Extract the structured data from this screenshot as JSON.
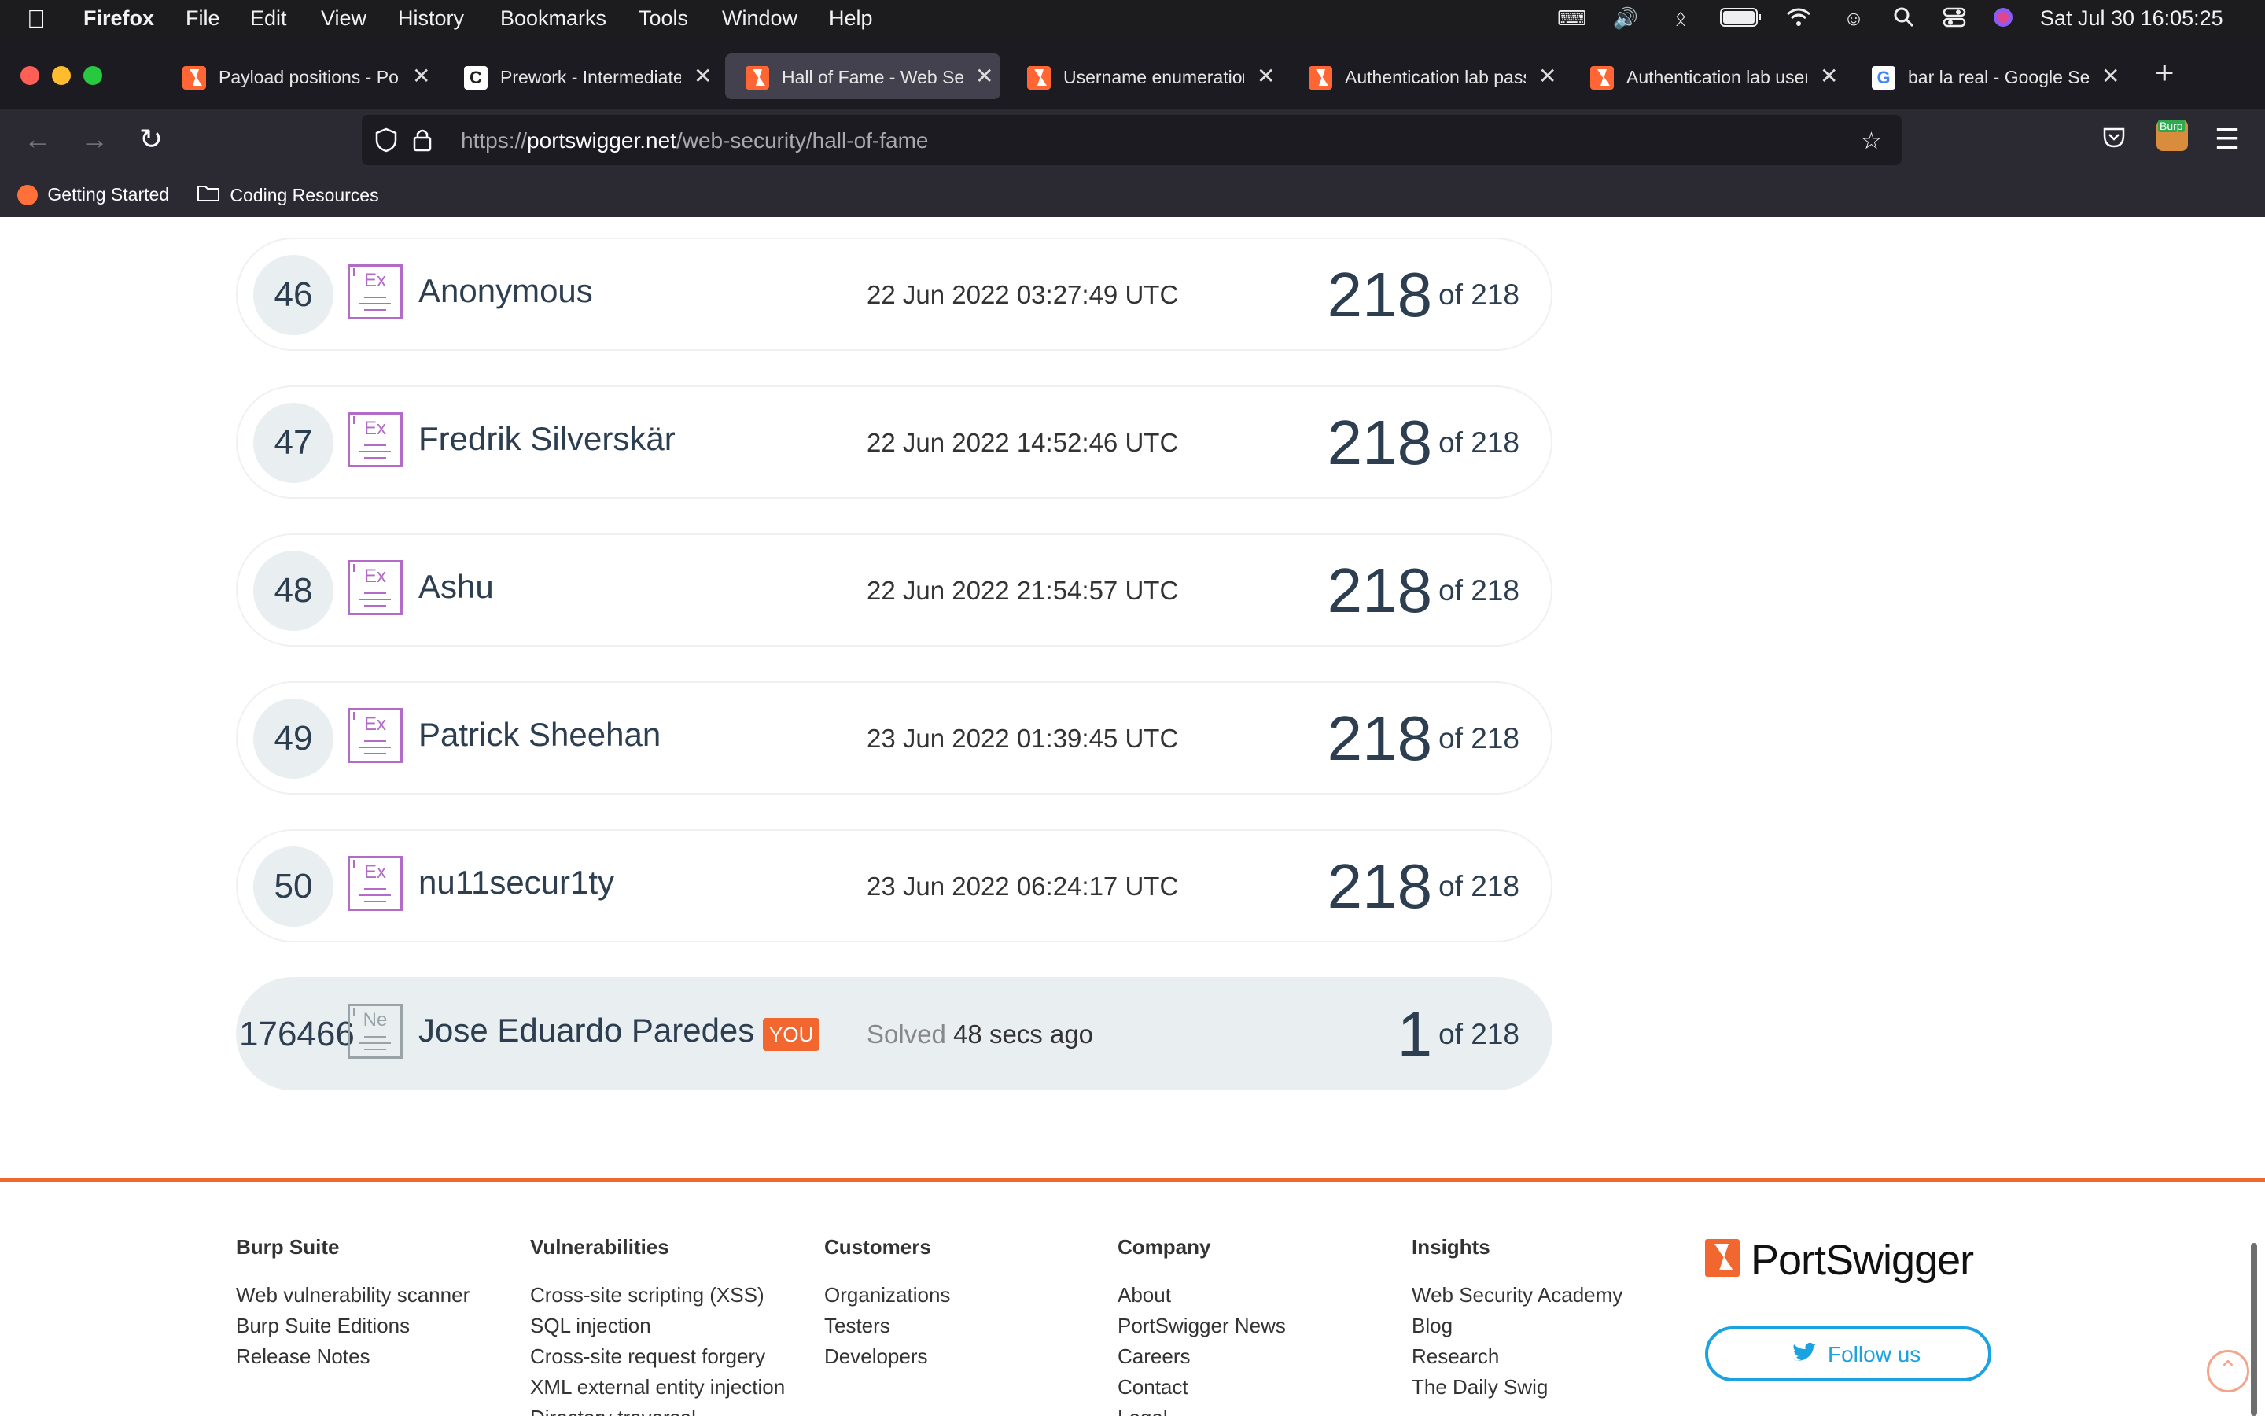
{
  "menubar": {
    "app": "Firefox",
    "items": [
      "File",
      "Edit",
      "View",
      "History",
      "Bookmarks",
      "Tools",
      "Window",
      "Help"
    ],
    "clock": "Sat Jul 30  16:05:25"
  },
  "tabs": [
    {
      "title": "Payload positions - Por",
      "favicon": "portswigger-icon"
    },
    {
      "title": "Prework - Intermediate",
      "favicon": "c-icon"
    },
    {
      "title": "Hall of Fame - Web Sec",
      "favicon": "portswigger-icon",
      "active": true
    },
    {
      "title": "Username enumeration",
      "favicon": "portswigger-icon"
    },
    {
      "title": "Authentication lab pass",
      "favicon": "portswigger-icon"
    },
    {
      "title": "Authentication lab user",
      "favicon": "portswigger-icon"
    },
    {
      "title": "bar la real - Google Sea",
      "favicon": "google-icon"
    }
  ],
  "urlbar": {
    "scheme": "https://",
    "host": "portswigger.net",
    "path": "/web-security/hall-of-fame"
  },
  "extension_label": "Burp",
  "bookmarks": [
    "Getting Started",
    "Coding Resources"
  ],
  "entries": [
    {
      "rank": "46",
      "badge": "Ex",
      "name": "Anonymous",
      "date": "22 Jun 2022 03:27:49 UTC",
      "score": "218",
      "of": "of 218"
    },
    {
      "rank": "47",
      "badge": "Ex",
      "name": "Fredrik Silverskär",
      "date": "22 Jun 2022 14:52:46 UTC",
      "score": "218",
      "of": "of 218"
    },
    {
      "rank": "48",
      "badge": "Ex",
      "name": "Ashu",
      "date": "22 Jun 2022 21:54:57 UTC",
      "score": "218",
      "of": "of 218"
    },
    {
      "rank": "49",
      "badge": "Ex",
      "name": "Patrick Sheehan",
      "date": "23 Jun 2022 01:39:45 UTC",
      "score": "218",
      "of": "of 218"
    },
    {
      "rank": "50",
      "badge": "Ex",
      "name": "nu11secur1ty",
      "date": "23 Jun 2022 06:24:17 UTC",
      "score": "218",
      "of": "of 218"
    }
  ],
  "you_entry": {
    "rank": "176466",
    "badge": "Ne",
    "name": "Jose Eduardo Paredes",
    "you_label": "YOU",
    "solved_label": "Solved",
    "solved_time": "48 secs ago",
    "score": "1",
    "of": "of 218"
  },
  "footer": {
    "columns": [
      {
        "heading": "Burp Suite",
        "links": [
          "Web vulnerability scanner",
          "Burp Suite Editions",
          "Release Notes"
        ]
      },
      {
        "heading": "Vulnerabilities",
        "links": [
          "Cross-site scripting (XSS)",
          "SQL injection",
          "Cross-site request forgery",
          "XML external entity injection",
          "Directory traversal"
        ]
      },
      {
        "heading": "Customers",
        "links": [
          "Organizations",
          "Testers",
          "Developers"
        ]
      },
      {
        "heading": "Company",
        "links": [
          "About",
          "PortSwigger News",
          "Careers",
          "Contact",
          "Legal"
        ]
      },
      {
        "heading": "Insights",
        "links": [
          "Web Security Academy",
          "Blog",
          "Research",
          "The Daily Swig"
        ]
      }
    ],
    "brand": "PortSwigger",
    "follow_label": "Follow us"
  },
  "colors": {
    "accent": "#f26630",
    "expert_badge": "#b26bc7",
    "twitter": "#1ba2e0",
    "row_bg_you": "#e9eef1"
  }
}
